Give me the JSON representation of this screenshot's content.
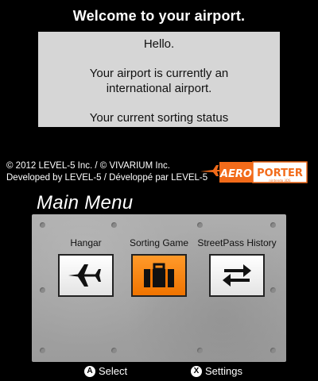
{
  "top": {
    "title": "Welcome to your airport.",
    "message": {
      "hello": "Hello.",
      "line2": "Your airport is currently an international airport.",
      "line3": "Your current sorting status"
    },
    "copyright": {
      "line1": "© 2012 LEVEL-5 Inc. / © VIVARIUM Inc.",
      "line2": "Developed by LEVEL-5 / Développé par LEVEL-5"
    },
    "logo": {
      "left": "AERO",
      "right": "PORTER",
      "tag": "nintendo 3DS"
    }
  },
  "menu": {
    "title": "Main Menu",
    "items": [
      {
        "label": "Hangar",
        "icon": "airplane-icon",
        "selected": false
      },
      {
        "label": "Sorting Game",
        "icon": "suitcase-icon",
        "selected": true
      },
      {
        "label": "StreetPass History",
        "icon": "exchange-arrows-icon",
        "selected": false
      }
    ]
  },
  "footer": {
    "select_button": "A",
    "select_label": "Select",
    "settings_button": "X",
    "settings_label": "Settings"
  },
  "colors": {
    "accent": "#f07400",
    "panel": "#d6d6d6",
    "logo_orange": "#f26b1a"
  }
}
